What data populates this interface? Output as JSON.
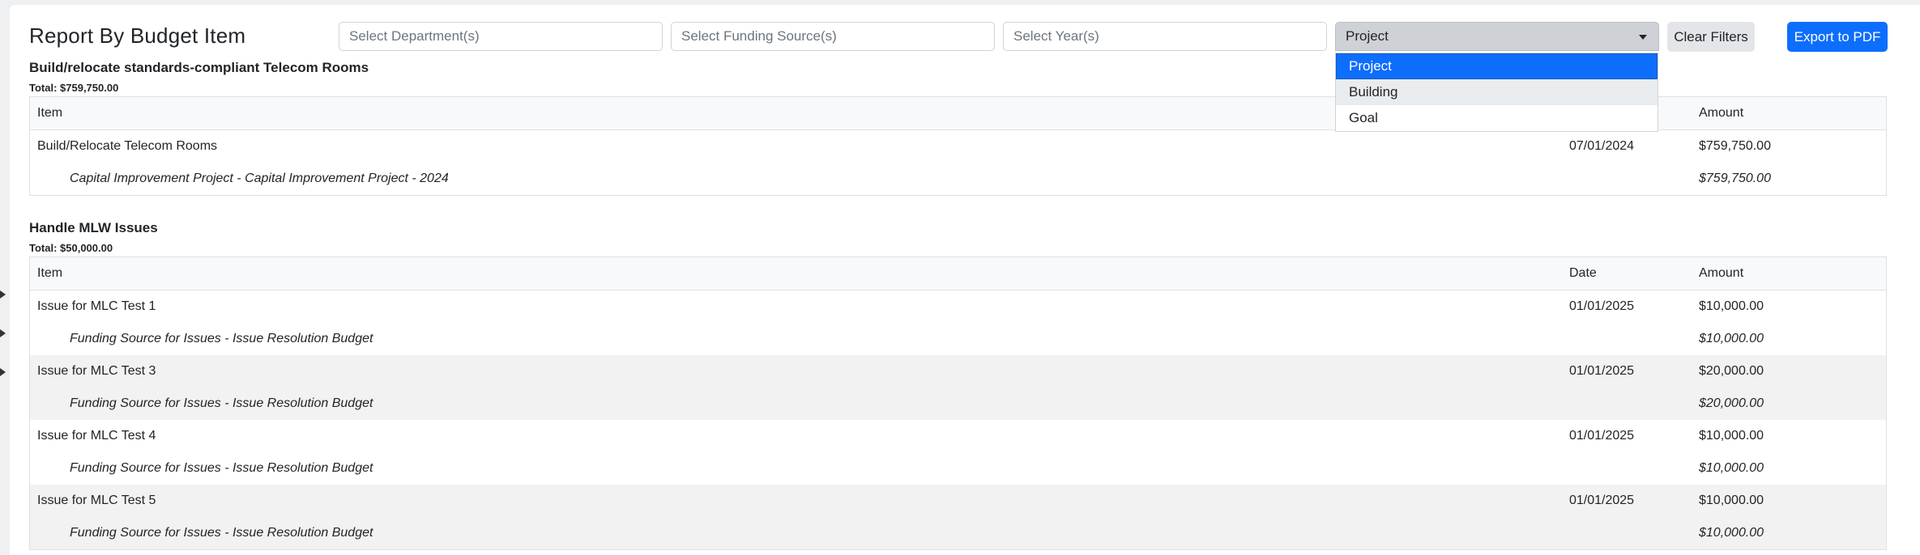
{
  "page": {
    "title": "Report By Budget Item"
  },
  "filters": {
    "department_placeholder": "Select Department(s)",
    "funding_placeholder": "Select Funding Source(s)",
    "year_placeholder": "Select Year(s)",
    "group_by_value": "Project",
    "group_by_options": [
      "Project",
      "Building",
      "Goal"
    ],
    "clear_label": "Clear Filters",
    "export_label": "Export to PDF"
  },
  "columns": {
    "item": "Item",
    "date": "Date",
    "amount": "Amount"
  },
  "sections": [
    {
      "title": "Build/relocate standards-compliant Telecom Rooms",
      "total": "Total: $759,750.00",
      "rows": [
        {
          "item": "Build/Relocate Telecom Rooms",
          "date": "07/01/2024",
          "amount": "$759,750.00",
          "sub": "Capital Improvement Project - Capital Improvement Project - 2024",
          "sub_amount": "$759,750.00"
        }
      ]
    },
    {
      "title": "Handle MLW Issues",
      "total": "Total: $50,000.00",
      "rows": [
        {
          "item": "Issue for MLC Test 1",
          "date": "01/01/2025",
          "amount": "$10,000.00",
          "sub": "Funding Source for Issues - Issue Resolution Budget",
          "sub_amount": "$10,000.00"
        },
        {
          "item": "Issue for MLC Test 3",
          "date": "01/01/2025",
          "amount": "$20,000.00",
          "sub": "Funding Source for Issues - Issue Resolution Budget",
          "sub_amount": "$20,000.00"
        },
        {
          "item": "Issue for MLC Test 4",
          "date": "01/01/2025",
          "amount": "$10,000.00",
          "sub": "Funding Source for Issues - Issue Resolution Budget",
          "sub_amount": "$10,000.00"
        },
        {
          "item": "Issue for MLC Test 5",
          "date": "01/01/2025",
          "amount": "$10,000.00",
          "sub": "Funding Source for Issues - Issue Resolution Budget",
          "sub_amount": "$10,000.00"
        }
      ]
    }
  ]
}
